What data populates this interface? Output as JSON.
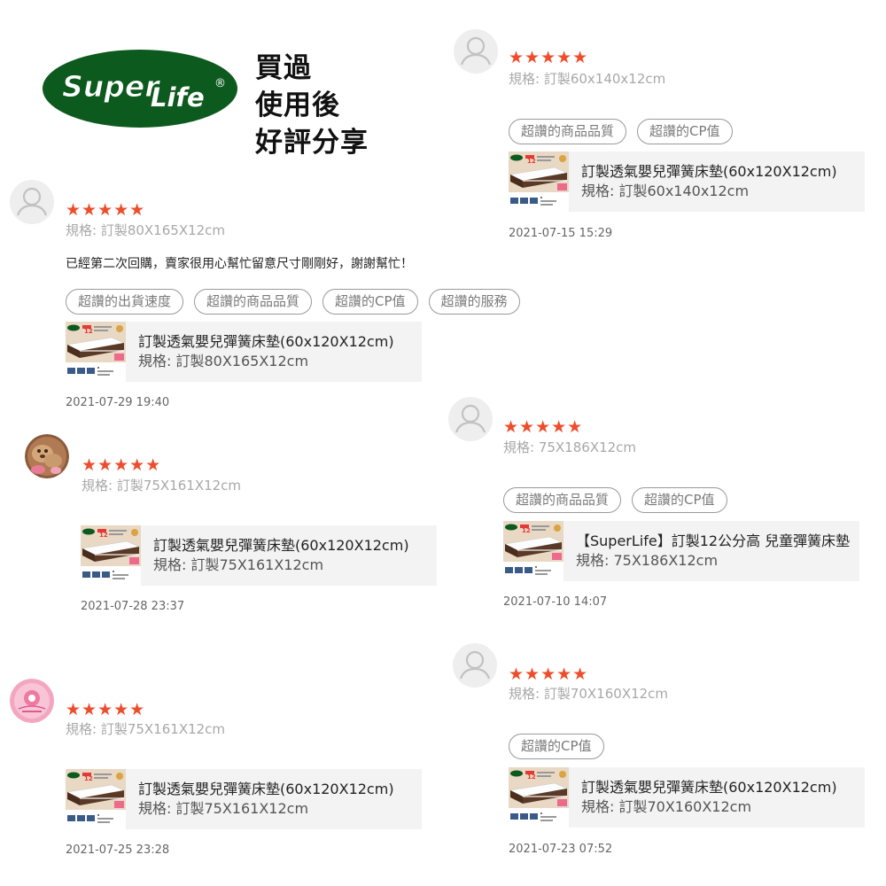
{
  "brand": {
    "logo_text": "SuperLife®",
    "headline": [
      "買過",
      "使用後",
      "好評分享"
    ],
    "colors": {
      "logo_green": "#0d5a1e",
      "star": "#ee4d2d",
      "card_bg": "#f3f3f3"
    }
  },
  "reviews": [
    {
      "avatar": "default-user-icon",
      "rating": "★★★★★",
      "spec": "規格: 訂製60x140x12cm",
      "tags": [
        "超讚的商品品質",
        "超讚的CP值"
      ],
      "product": {
        "name": "訂製透氣嬰兒彈簧床墊(60x120X12cm)",
        "spec": "規格: 訂製60x140x12cm"
      },
      "date": "2021-07-15 15:29"
    },
    {
      "avatar": "default-user-icon",
      "rating": "★★★★★",
      "spec": "規格: 訂製80X165X12cm",
      "comment": "已經第二次回購，賣家很用心幫忙留意尺寸剛剛好，謝謝幫忙！",
      "tags": [
        "超讚的出貨速度",
        "超讚的商品品質",
        "超讚的CP值",
        "超讚的服務"
      ],
      "product": {
        "name": "訂製透氣嬰兒彈簧床墊(60x120X12cm)",
        "spec": "規格: 訂製80X165X12cm"
      },
      "date": "2021-07-29 19:40"
    },
    {
      "avatar": "default-user-icon",
      "rating": "★★★★★",
      "spec": "規格: 75X186X12cm",
      "tags": [
        "超讚的商品品質",
        "超讚的CP值"
      ],
      "product": {
        "name": "【SuperLife】訂製12公分高 兒童彈簧床墊",
        "spec": "規格: 75X186X12cm"
      },
      "date": "2021-07-10 14:07"
    },
    {
      "avatar": "photo-avatar",
      "rating": "★★★★★",
      "spec": "規格: 訂製75X161X12cm",
      "product": {
        "name": "訂製透氣嬰兒彈簧床墊(60x120X12cm)",
        "spec": "規格: 訂製75X161X12cm"
      },
      "date": "2021-07-28 23:37"
    },
    {
      "avatar": "default-user-icon",
      "rating": "★★★★★",
      "spec": "規格: 訂製70X160X12cm",
      "tags": [
        "超讚的CP值"
      ],
      "product": {
        "name": "訂製透氣嬰兒彈簧床墊(60x120X12cm)",
        "spec": "規格: 訂製70X160X12cm"
      },
      "date": "2021-07-23 07:52"
    },
    {
      "avatar": "pink-logo-avatar",
      "rating": "★★★★★",
      "spec": "規格: 訂製75X161X12cm",
      "product": {
        "name": "訂製透氣嬰兒彈簧床墊(60x120X12cm)",
        "spec": "規格: 訂製75X161X12cm"
      },
      "date": "2021-07-25 23:28"
    }
  ]
}
